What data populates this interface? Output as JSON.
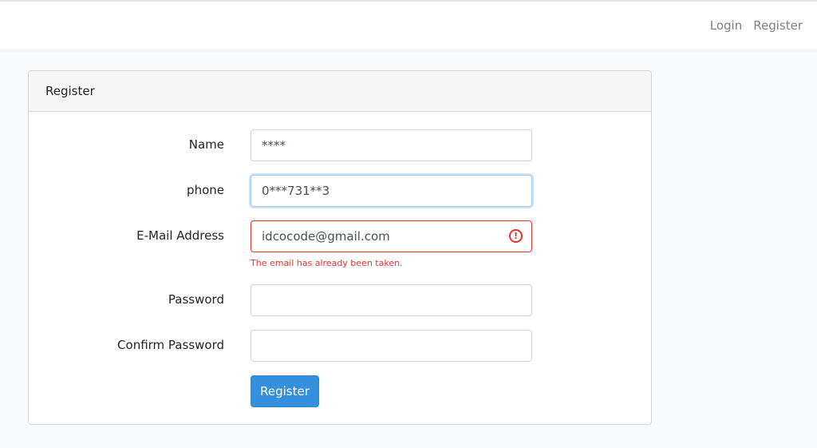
{
  "nav": {
    "login": "Login",
    "register": "Register"
  },
  "card": {
    "title": "Register"
  },
  "form": {
    "name": {
      "label": "Name",
      "value": "****"
    },
    "phone": {
      "label": "phone",
      "value": "0***731**3"
    },
    "email": {
      "label": "E-Mail Address",
      "value": "idcocode@gmail.com",
      "error": "The email has already been taken."
    },
    "password": {
      "label": "Password",
      "value": ""
    },
    "confirm_password": {
      "label": "Confirm Password",
      "value": ""
    },
    "submit_label": "Register"
  },
  "icons": {
    "email_error": "exclamation-circle-icon"
  },
  "colors": {
    "primary": "#3490dc",
    "danger": "#e3342f",
    "focus": "#a1cbef"
  }
}
